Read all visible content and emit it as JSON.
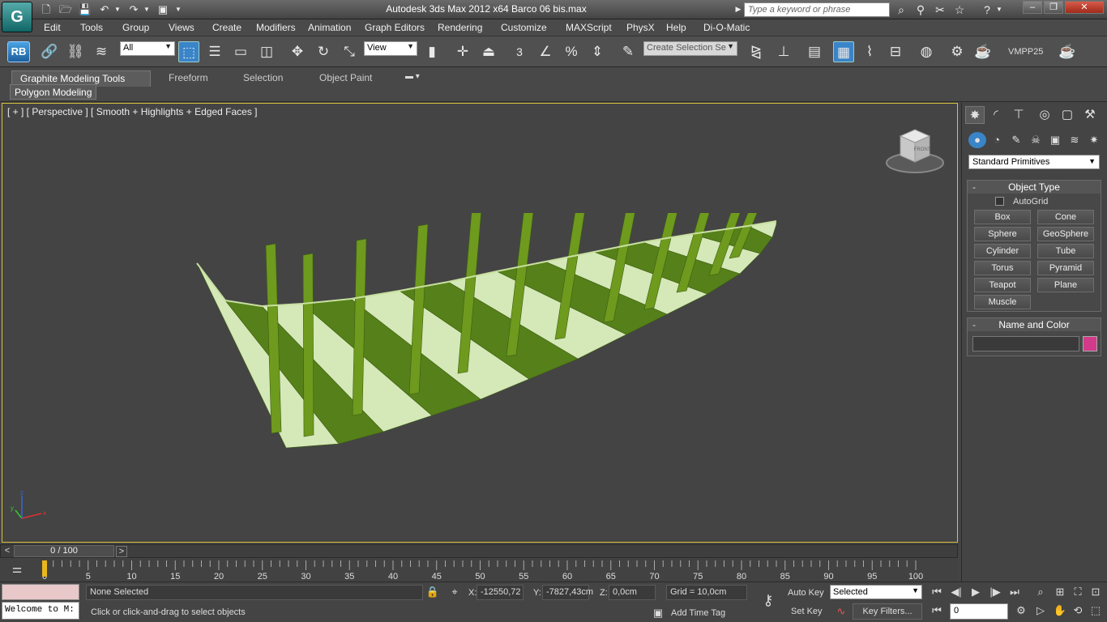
{
  "app": {
    "title": "Autodesk 3ds Max  2012 x64     Barco 06 bis.max",
    "search_placeholder": "Type a keyword or phrase"
  },
  "window_controls": {
    "minimize": "–",
    "restore": "❐",
    "close": "✕"
  },
  "menu": [
    "Edit",
    "Tools",
    "Group",
    "Views",
    "Create",
    "Modifiers",
    "Animation",
    "Graph Editors",
    "Rendering",
    "Customize",
    "MAXScript",
    "PhysX",
    "Help",
    "Di-O-Matic"
  ],
  "toolbar": {
    "rb_label": "RB",
    "filter_value": "All",
    "refcoord_value": "View",
    "selection_set_placeholder": "Create Selection Se",
    "vmpp_label": "VMPP25",
    "snap_label": "3",
    "percent_label": "%"
  },
  "ribbon": {
    "tabs": [
      "Graphite Modeling Tools",
      "Freeform",
      "Selection",
      "Object Paint"
    ],
    "active_tab": "Graphite Modeling Tools",
    "panel_label": "Polygon Modeling"
  },
  "viewport": {
    "label": "[ + ] [ Perspective ] [ Smooth + Highlights + Edged Faces ]",
    "viewcube_face": "FRONT",
    "axis_x": "x",
    "axis_y": "y",
    "axis_z": "z",
    "hull_color": "#6e9a1e",
    "hull_light_color": "#d4e8b8",
    "hull_dark_color": "#55801a"
  },
  "timeslider": {
    "value": "0 / 100",
    "prev": "<",
    "next": ">"
  },
  "trackbar": {
    "ticks": [
      "0",
      "5",
      "10",
      "15",
      "20",
      "25",
      "30",
      "35",
      "40",
      "45",
      "50",
      "55",
      "60",
      "65",
      "70",
      "75",
      "80",
      "85",
      "90",
      "95",
      "100"
    ]
  },
  "command_panel": {
    "primitive_type": "Standard Primitives",
    "object_type_title": "Object Type",
    "autogrid_label": "AutoGrid",
    "buttons": [
      "Box",
      "Cone",
      "Sphere",
      "GeoSphere",
      "Cylinder",
      "Tube",
      "Torus",
      "Pyramid",
      "Teapot",
      "Plane",
      "Muscle"
    ],
    "name_color_title": "Name and Color",
    "object_color": "#d23a8a"
  },
  "status": {
    "welcome": "Welcome to M:",
    "selection": "None Selected",
    "prompt": "Click or click-and-drag to select objects",
    "x_label": "X:",
    "x_value": "-12550,72",
    "y_label": "Y:",
    "y_value": "-7827,43cm",
    "z_label": "Z:",
    "z_value": "0,0cm",
    "grid": "Grid = 10,0cm",
    "add_time_tag": "Add Time Tag",
    "auto_key": "Auto Key",
    "set_key": "Set Key",
    "key_mode": "Selected",
    "key_filters": "Key Filters...",
    "frame_value": "0"
  }
}
